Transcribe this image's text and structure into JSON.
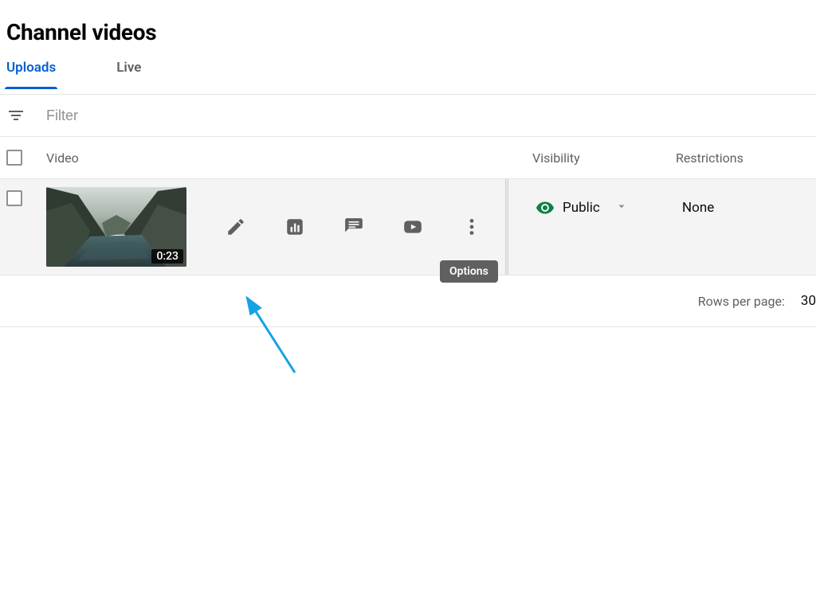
{
  "header": {
    "title": "Channel videos"
  },
  "tabs": [
    {
      "label": "Uploads",
      "active": true
    },
    {
      "label": "Live",
      "active": false
    }
  ],
  "filter": {
    "placeholder": "Filter"
  },
  "columns": {
    "video": "Video",
    "visibility": "Visibility",
    "restrictions": "Restrictions"
  },
  "row": {
    "duration": "0:23",
    "visibility": "Public",
    "restrictions": "None",
    "tooltip": "Options"
  },
  "pagination": {
    "rows_label": "Rows per page:",
    "rows_value": "30"
  },
  "icons": {
    "filter": "filter-icon",
    "edit": "pencil-icon",
    "analytics": "analytics-icon",
    "comments": "comments-icon",
    "play": "youtube-icon",
    "options": "more-vert-icon",
    "visibility": "eye-icon",
    "dropdown": "caret-down-icon"
  },
  "colors": {
    "accent": "#065fd4",
    "public_green": "#0b8043",
    "text_secondary": "#606060",
    "arrow": "#13a3e3"
  }
}
